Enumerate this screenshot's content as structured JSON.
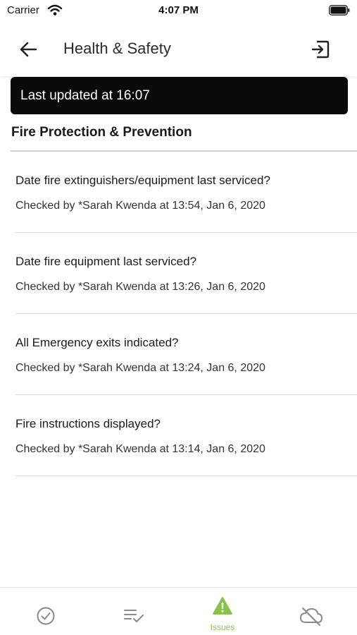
{
  "status_bar": {
    "carrier": "Carrier",
    "time": "4:07 PM"
  },
  "header": {
    "title": "Health & Safety",
    "back_icon": "arrow-left-icon",
    "exit_icon": "exit-icon"
  },
  "banner": {
    "text": "Last updated at 16:07"
  },
  "section": {
    "title": "Fire Protection & Prevention"
  },
  "items": [
    {
      "question": "Date fire extinguishers/equipment last serviced?",
      "meta": "Checked by *Sarah Kwenda at 13:54, Jan 6, 2020"
    },
    {
      "question": "Date fire equipment last serviced?",
      "meta": "Checked by *Sarah Kwenda at 13:26, Jan 6, 2020"
    },
    {
      "question": "All Emergency exits indicated?",
      "meta": "Checked by *Sarah Kwenda at 13:24, Jan 6, 2020"
    },
    {
      "question": "Fire instructions displayed?",
      "meta": "Checked by *Sarah Kwenda at 13:14, Jan 6, 2020"
    }
  ],
  "tabs": [
    {
      "icon": "check-circle-icon",
      "label": ""
    },
    {
      "icon": "checklist-icon",
      "label": ""
    },
    {
      "icon": "warning-icon",
      "label": "Issues",
      "active": true
    },
    {
      "icon": "cloud-off-icon",
      "label": ""
    }
  ],
  "colors": {
    "accent": "#8bc34a",
    "inactive": "#8a8a8a",
    "banner_bg": "#0a0a0a"
  }
}
